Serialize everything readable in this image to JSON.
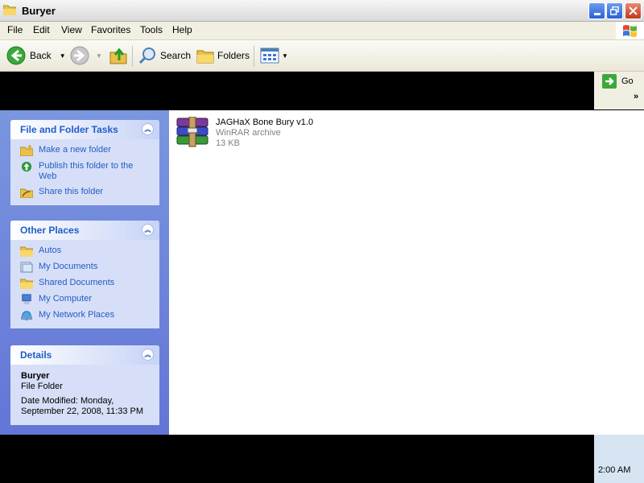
{
  "window": {
    "title": "Buryer"
  },
  "menu": [
    "File",
    "Edit",
    "View",
    "Favorites",
    "Tools",
    "Help"
  ],
  "toolbar": {
    "back": "Back",
    "search": "Search",
    "folders": "Folders"
  },
  "address": {
    "go": "Go",
    "chevron": "»"
  },
  "panels": {
    "file_tasks": {
      "title": "File and Folder Tasks",
      "items": [
        "Make a new folder",
        "Publish this folder to the Web",
        "Share this folder"
      ]
    },
    "other_places": {
      "title": "Other Places",
      "items": [
        "Autos",
        "My Documents",
        "Shared Documents",
        "My Computer",
        "My Network Places"
      ]
    },
    "details": {
      "title": "Details",
      "name": "Buryer",
      "type": "File Folder",
      "modified": "Date Modified: Monday, September 22, 2008, 11:33 PM"
    }
  },
  "file": {
    "name": "JAGHaX Bone Bury v1.0",
    "type": "WinRAR archive",
    "size": "13 KB"
  },
  "taskbar": {
    "clock": "2:00 AM"
  },
  "colors": {
    "task_link": "#215dc6",
    "pane_bg": "#6f85da",
    "close": "#c2381a"
  }
}
